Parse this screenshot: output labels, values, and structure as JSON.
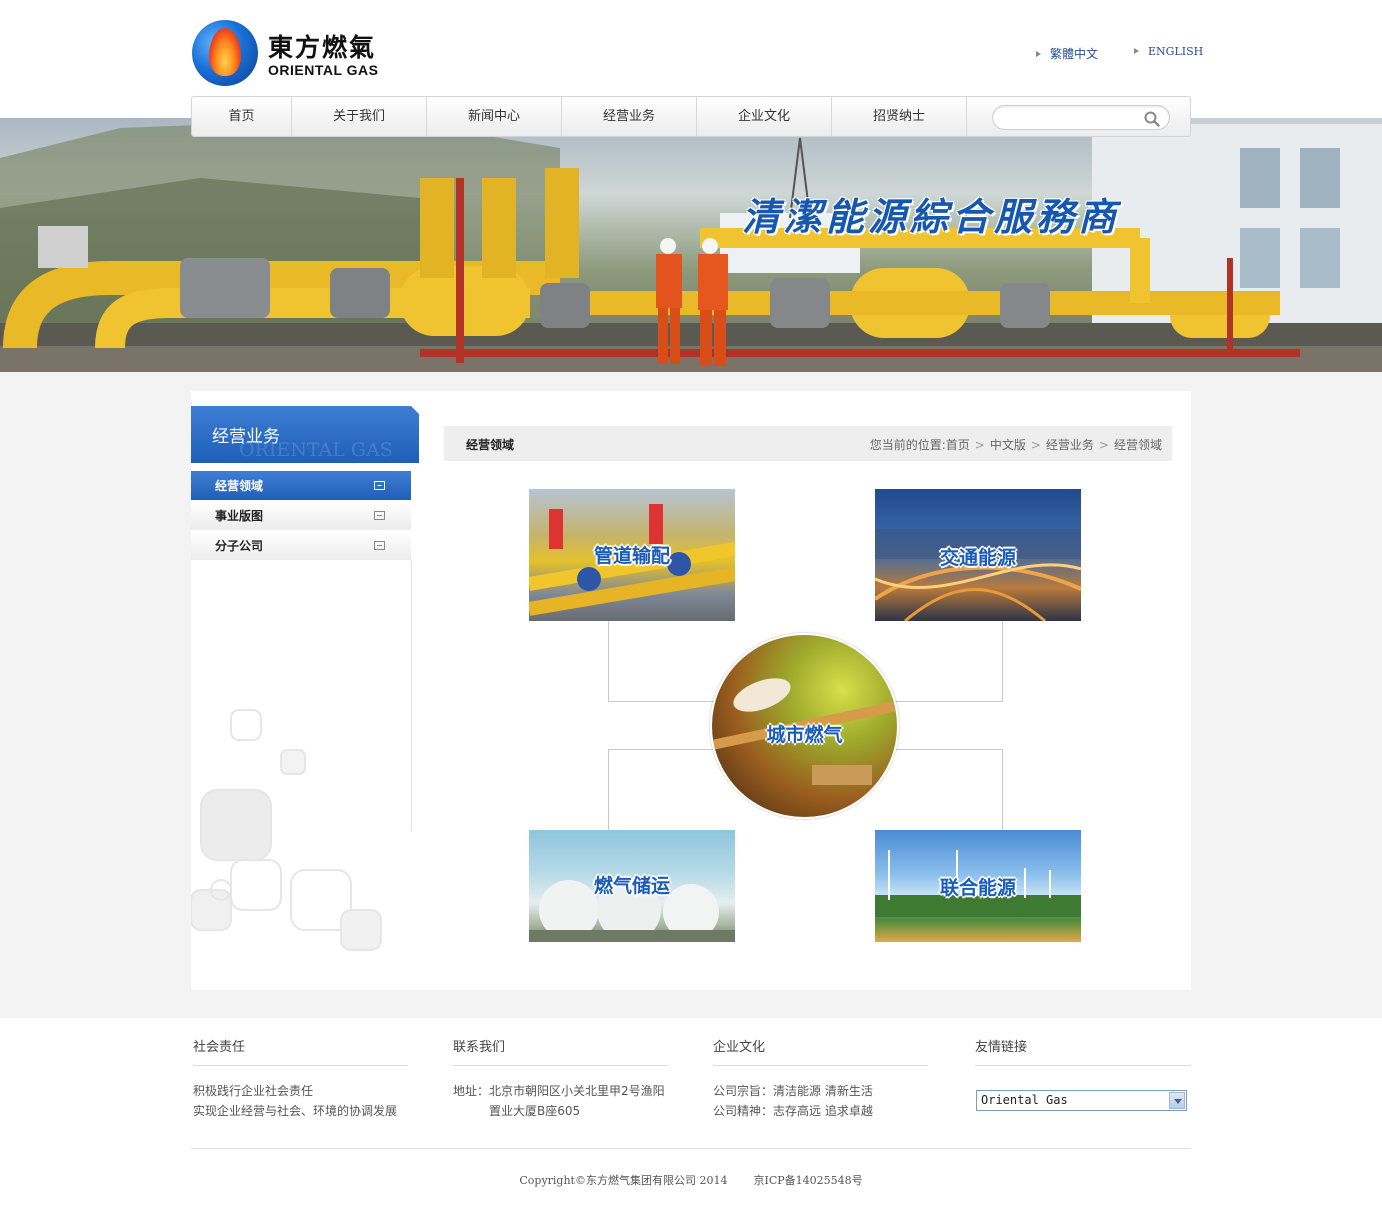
{
  "logo": {
    "cn": "東方燃氣",
    "en": "ORIENTAL GAS"
  },
  "lang": {
    "traditional": "繁體中文",
    "english": "ENGLISH"
  },
  "nav": {
    "items": [
      "首页",
      "关于我们",
      "新闻中心",
      "经营业务",
      "企业文化",
      "招贤纳士"
    ],
    "search_placeholder": ""
  },
  "banner": {
    "slogan": "清潔能源綜合服務商"
  },
  "sidebar": {
    "title": "经营业务",
    "title_en": "ORIENTAL GAS",
    "items": [
      "经营领域",
      "事业版图",
      "分子公司"
    ],
    "active_index": 0
  },
  "content": {
    "title": "经营领域",
    "breadcrumb_prefix": "您当前的位置:",
    "breadcrumb": [
      "首页",
      "中文版",
      "经营业务",
      "经营领域"
    ],
    "tiles": {
      "pipeline": "管道输配",
      "transport": "交通能源",
      "city_gas": "城市燃气",
      "storage": "燃气储运",
      "combined": "联合能源"
    }
  },
  "footer": {
    "social": {
      "title": "社会责任",
      "lines": [
        "积极践行企业社会责任",
        "实现企业经营与社会、环境的协调发展"
      ]
    },
    "contact": {
      "title": "联系我们",
      "address_label": "地址：",
      "address_line1": "北京市朝阳区小关北里甲2号渔阳",
      "address_line2": "置业大厦B座605"
    },
    "culture": {
      "title": "企业文化",
      "lines": [
        "公司宗旨：清洁能源 清新生活",
        "公司精神：志存高远 追求卓越"
      ]
    },
    "links": {
      "title": "友情链接",
      "selected": "Oriental Gas"
    },
    "copyright": "Copyright©东方燃气集团有限公司 2014",
    "icp": "京ICP备14025548号"
  }
}
